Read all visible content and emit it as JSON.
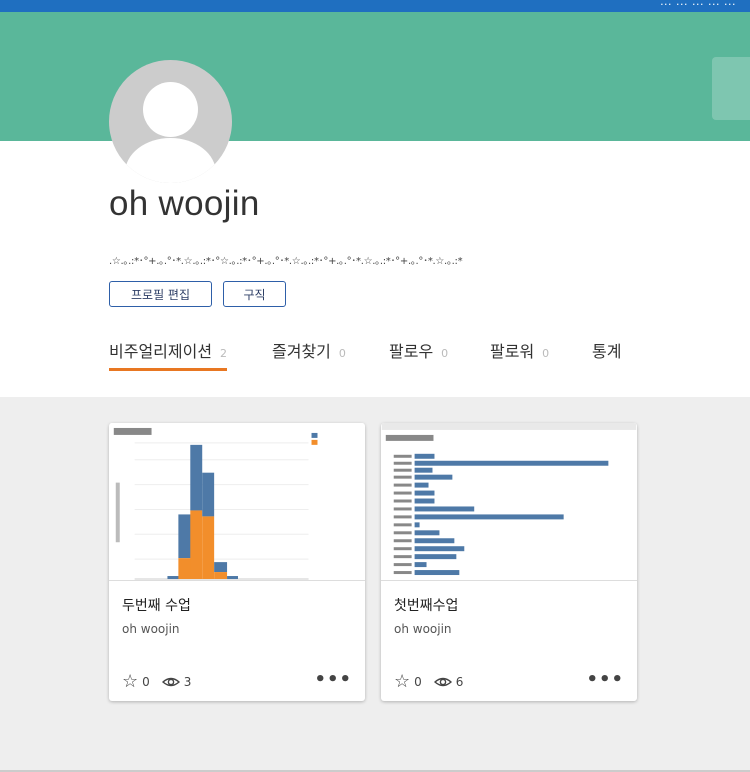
{
  "topbar": {
    "text": "... ... ... ... ..."
  },
  "profile": {
    "name": "oh woojin",
    "bio": ".☆.｡.:*･°+.｡.°･*.☆.｡.:*･°☆.｡.:*･°+.｡.°･*.☆.｡.:*･°+.｡.°･*.☆.｡.:*･°+.｡.°･*.☆.｡.:*",
    "edit_button": "프로필 편집",
    "follow_button": "구직"
  },
  "tabs": [
    {
      "label": "비주얼리제이션",
      "count": "2"
    },
    {
      "label": "즐겨찾기",
      "count": "0"
    },
    {
      "label": "팔로우",
      "count": "0"
    },
    {
      "label": "팔로워",
      "count": "0"
    },
    {
      "label": "통계",
      "count": ""
    }
  ],
  "cards": [
    {
      "title": "두번째 수업",
      "author": "oh woojin",
      "favorites": "0",
      "views": "3"
    },
    {
      "title": "첫번째수업",
      "author": "oh woojin",
      "favorites": "0",
      "views": "6"
    }
  ],
  "colors": {
    "accent": "#e87722",
    "banner": "#5ab79a",
    "bar_blue": "#4e79a7",
    "bar_orange": "#f28e2b"
  }
}
